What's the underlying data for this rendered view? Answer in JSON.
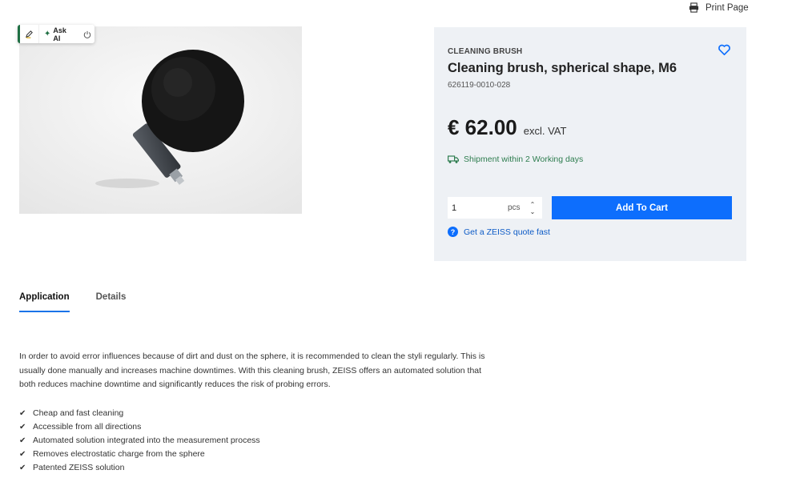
{
  "header": {
    "print_label": "Print Page"
  },
  "ai_toolbar": {
    "ask_label": "Ask AI"
  },
  "product": {
    "category": "CLEANING BRUSH",
    "title": "Cleaning brush, spherical shape, M6",
    "sku": "626119-0010-028",
    "price": "€ 62.00",
    "vat_note": "excl. VAT",
    "shipment": "Shipment within 2 Working days",
    "quantity": "1",
    "unit": "pcs",
    "add_to_cart": "Add To Cart",
    "quote_link": "Get a ZEISS quote fast"
  },
  "tabs": [
    {
      "label": "Application",
      "active": true
    },
    {
      "label": "Details",
      "active": false
    }
  ],
  "application": {
    "description": "In order to avoid error influences because of dirt and dust on the sphere, it is recommended to clean the styli regularly. This is usually done manually and increases machine downtimes. With this cleaning brush, ZEISS offers an automated solution that both reduces machine downtime and significantly reduces the risk of probing errors.",
    "features": [
      "Cheap and fast cleaning",
      "Accessible from all directions",
      "Automated solution integrated into the measurement process",
      "Removes electrostatic charge from the sphere",
      "Patented ZEISS solution"
    ]
  },
  "colors": {
    "accent": "#0d6efd",
    "shipment": "#2e7d4f",
    "buy_box_bg": "#eef1f5"
  },
  "icons": [
    "printer-icon",
    "pencil-icon",
    "sparkle-icon",
    "power-icon",
    "heart-icon",
    "truck-icon",
    "help-icon",
    "check-icon"
  ]
}
